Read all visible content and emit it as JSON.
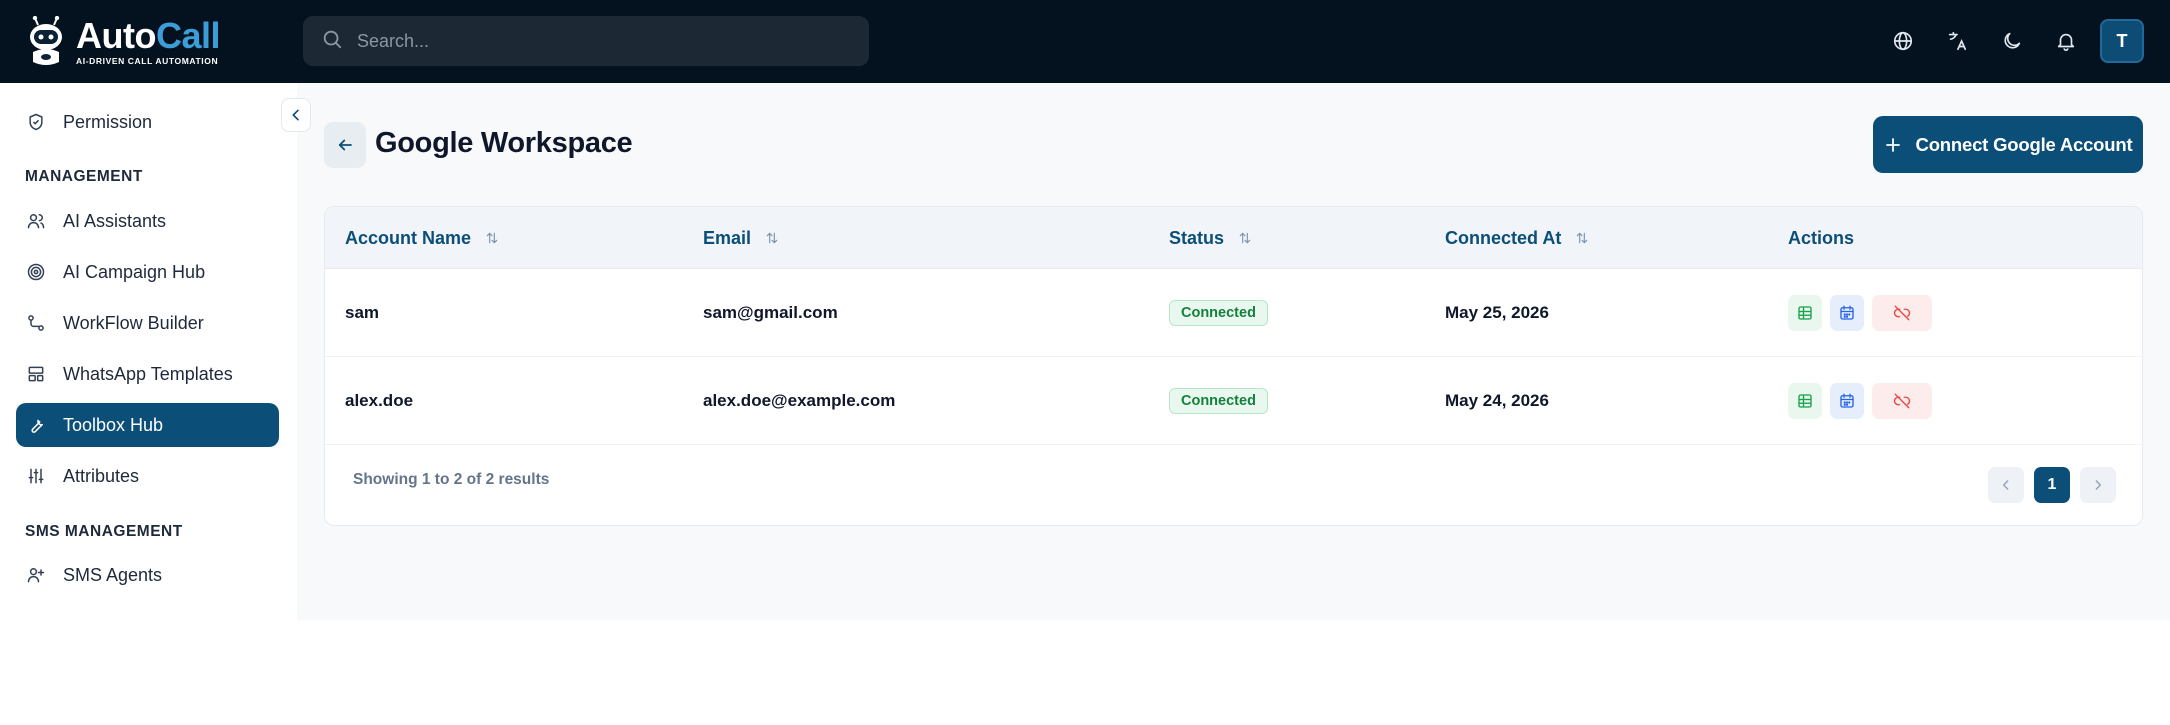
{
  "brand": {
    "name_part1": "Auto",
    "name_part2": "Call",
    "tagline": "AI-DRIVEN CALL AUTOMATION"
  },
  "search": {
    "placeholder": "Search..."
  },
  "user": {
    "initial": "T"
  },
  "colors": {
    "primary": "#0b4e78",
    "topbar": "#04121f",
    "success": "#15803d",
    "danger": "#ef4444"
  },
  "sidebar": {
    "items": [
      {
        "label": "Permission",
        "icon": "shield-check-icon"
      },
      {
        "label": "AI Assistants",
        "icon": "users-icon"
      },
      {
        "label": "AI Campaign Hub",
        "icon": "target-icon"
      },
      {
        "label": "WorkFlow Builder",
        "icon": "workflow-icon"
      },
      {
        "label": "WhatsApp Templates",
        "icon": "layout-icon"
      },
      {
        "label": "Toolbox Hub",
        "icon": "wrench-icon",
        "active": true
      },
      {
        "label": "Attributes",
        "icon": "sliders-icon"
      },
      {
        "label": "SMS Agents",
        "icon": "user-plus-icon"
      }
    ],
    "headings": {
      "management": "MANAGEMENT",
      "sms_management": "SMS MANAGEMENT"
    }
  },
  "page": {
    "title": "Google Workspace",
    "connect_label": "Connect Google Account"
  },
  "table": {
    "columns": [
      "Account Name",
      "Email",
      "Status",
      "Connected At",
      "Actions"
    ],
    "rows": [
      {
        "account": "sam",
        "email": "sam@gmail.com",
        "status": "Connected",
        "connected_at": "May 25, 2026"
      },
      {
        "account": "alex.doe",
        "email": "alex.doe@example.com",
        "status": "Connected",
        "connected_at": "May 24, 2026"
      }
    ],
    "footer": "Showing 1 to 2 of 2 results",
    "current_page": "1"
  }
}
